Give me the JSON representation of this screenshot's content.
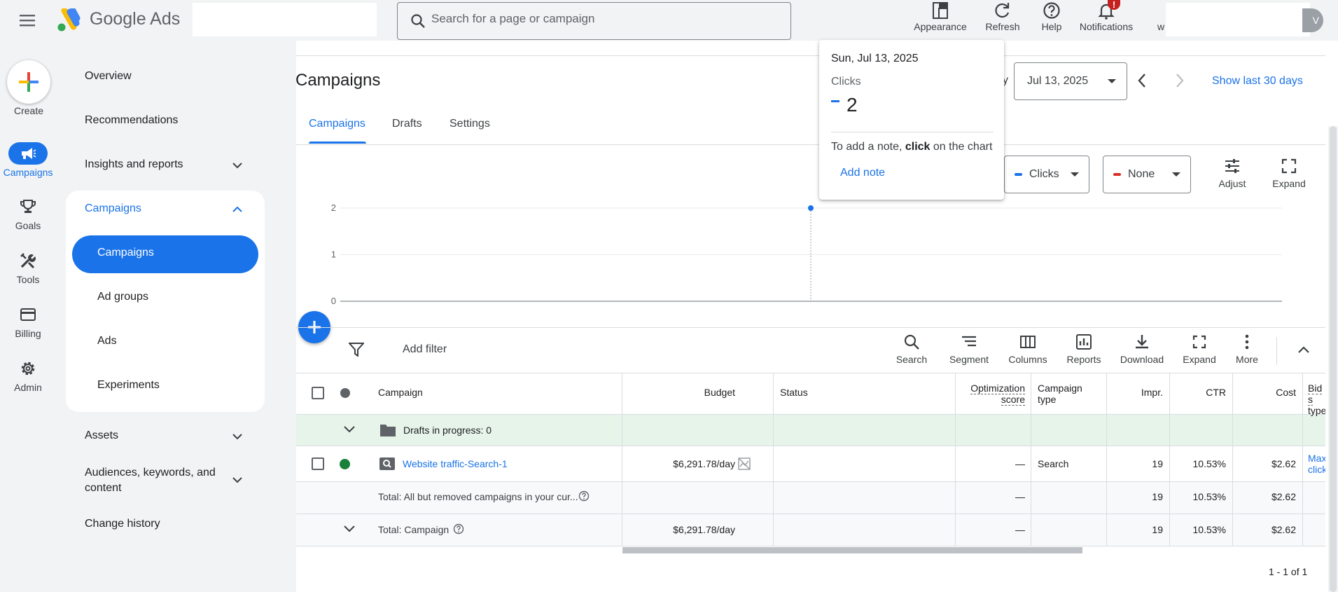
{
  "app": {
    "brand": "Google Ads"
  },
  "search": {
    "placeholder": "Search for a page or campaign"
  },
  "top_actions": [
    {
      "label": "Appearance",
      "icon": "appearance-icon"
    },
    {
      "label": "Refresh",
      "icon": "refresh-icon"
    },
    {
      "label": "Help",
      "icon": "help-icon"
    },
    {
      "label": "Notifications",
      "icon": "bell-icon",
      "badge": "!"
    }
  ],
  "user": {
    "initial_partial": "w",
    "avatar_edge": "V"
  },
  "rail": {
    "create_label": "Create",
    "items": [
      {
        "label": "Campaigns",
        "icon": "megaphone-icon",
        "active": true
      },
      {
        "label": "Goals",
        "icon": "trophy-icon"
      },
      {
        "label": "Tools",
        "icon": "tools-icon"
      },
      {
        "label": "Billing",
        "icon": "credit-card-icon"
      },
      {
        "label": "Admin",
        "icon": "gear-icon"
      }
    ]
  },
  "nav": {
    "overview": "Overview",
    "recommendations": "Recommendations",
    "insights": "Insights and reports",
    "campaigns_group": "Campaigns",
    "sub": [
      "Campaigns",
      "Ad groups",
      "Ads",
      "Experiments"
    ],
    "assets": "Assets",
    "audiences_line1": "Audiences, keywords, and",
    "audiences_line2": "content",
    "change_history": "Change history"
  },
  "page": {
    "title": "Campaigns",
    "tabs": [
      "Campaigns",
      "Drafts",
      "Settings"
    ],
    "date_value": "Jul 13, 2025",
    "date_prefix_partial": "y",
    "show_last": "Show last 30 days"
  },
  "chart_controls": {
    "metric1": "Clicks",
    "metric1_color": "#1a73e8",
    "metric2": "None",
    "metric2_color": "#d93025",
    "adjust": "Adjust",
    "expand": "Expand"
  },
  "chart_data": {
    "type": "line",
    "series": [
      {
        "name": "Clicks",
        "x": [
          "Jul 13, 2025"
        ],
        "values": [
          2
        ]
      }
    ],
    "ylim": [
      0,
      2
    ],
    "yticks": [
      "0",
      "1",
      "2"
    ],
    "grid": true,
    "color": "#1a73e8"
  },
  "tooltip": {
    "date": "Sun, Jul 13, 2025",
    "metric": "Clicks",
    "value": "2",
    "note_prefix": "To add a note, ",
    "note_bold": "click",
    "note_suffix": " on the chart",
    "add_note": "Add note"
  },
  "filter": {
    "add_filter": "Add filter"
  },
  "table_tools": [
    "Search",
    "Segment",
    "Columns",
    "Reports",
    "Download",
    "Expand",
    "More"
  ],
  "table": {
    "headers": {
      "campaign": "Campaign",
      "budget": "Budget",
      "status": "Status",
      "opt_line1": "Optimization",
      "opt_line2": "score",
      "type_line1": "Campaign",
      "type_line2": "type",
      "impr": "Impr.",
      "ctr": "CTR",
      "cost": "Cost",
      "bid_line1": "Bid s",
      "bid_line2": "type"
    },
    "drafts": "Drafts in progress: 0",
    "rows": [
      {
        "campaign": "Website traffic-Search-1",
        "budget": "$6,291.78/day",
        "status": "",
        "opt": "—",
        "type": "Search",
        "impr": "19",
        "ctr": "10.53%",
        "cost": "$2.62",
        "bid_line1": "Max",
        "bid_line2": "click"
      }
    ],
    "total_all": {
      "label": "Total: All but removed campaigns in your cur...",
      "opt": "—",
      "impr": "19",
      "ctr": "10.53%",
      "cost": "$2.62"
    },
    "total_campaign": {
      "label": "Total: Campaign",
      "budget": "$6,291.78/day",
      "opt": "—",
      "impr": "19",
      "ctr": "10.53%",
      "cost": "$2.62"
    },
    "pager": "1 - 1 of 1"
  }
}
